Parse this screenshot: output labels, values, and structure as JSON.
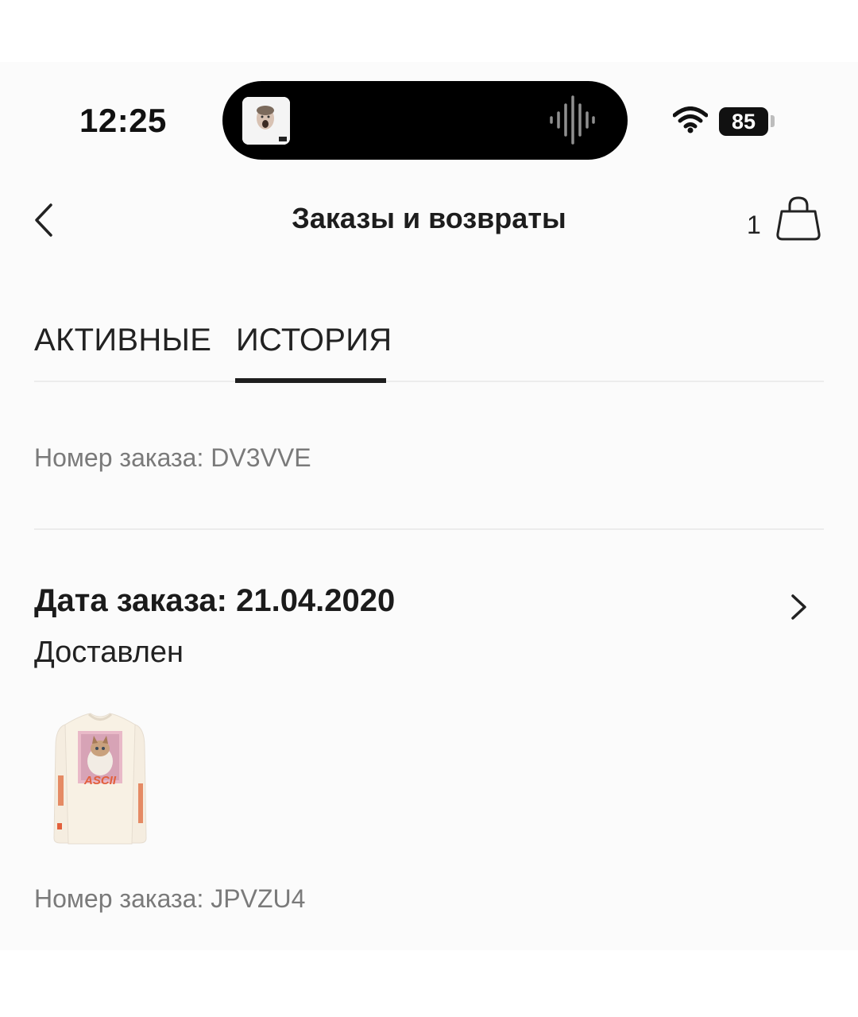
{
  "status_bar": {
    "time": "12:25",
    "battery": "85"
  },
  "header": {
    "title": "Заказы и возвраты",
    "cart_count": "1"
  },
  "tabs": [
    {
      "label": "АКТИВНЫЕ",
      "active": false
    },
    {
      "label": "ИСТОРИЯ",
      "active": true
    }
  ],
  "orders": [
    {
      "number_text": "Номер заказа: DV3VVE"
    },
    {
      "date_text": "Дата заказа: 21.04.2020",
      "status": "Доставлен",
      "number_text": "Номер заказа: JPVZU4",
      "thumb_print_text": "ASCII"
    }
  ],
  "colors": {
    "accent": "#1e1e1e",
    "muted_text": "#7a7a7a",
    "divider": "#ececec",
    "print_orange": "#e2603c"
  }
}
